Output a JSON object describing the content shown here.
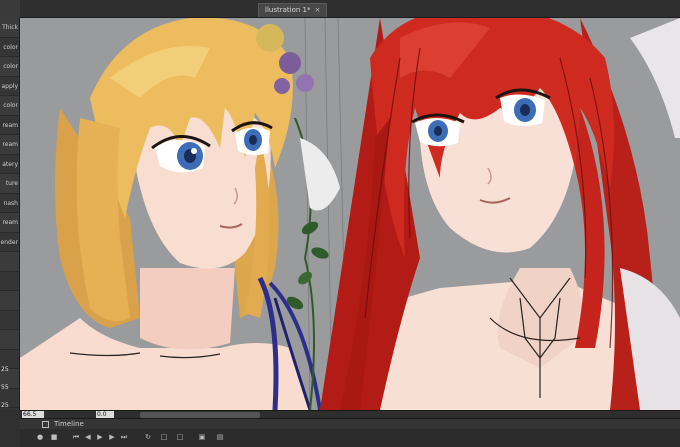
{
  "app": {
    "document_tab": "llustration 1*",
    "tab_close": "×"
  },
  "left_panel": {
    "items": [
      "Thick",
      "color",
      "color",
      "apply",
      "color",
      "ream",
      "ream",
      "atery",
      "ture",
      "nash",
      "ream",
      "ender",
      "",
      "",
      "",
      "",
      "",
      "",
      "",
      ""
    ],
    "numbers": [
      "25",
      "55",
      "25"
    ]
  },
  "status": {
    "zoom": "66.5",
    "rotation": "0.0"
  },
  "timeline": {
    "title": "Timeline",
    "controls": [
      "record-icon",
      "stop-icon",
      "first-frame-icon",
      "prev-frame-icon",
      "play-icon",
      "next-frame-icon",
      "last-frame-icon",
      "loop-icon",
      "add-frame-icon",
      "delete-frame-icon",
      "onion-skin-icon",
      "settings-icon"
    ]
  },
  "colors": {
    "canvas_bg": "#9a9b9d",
    "panel_bg": "#353535",
    "blonde_hair": "#e9b85a",
    "red_hair": "#c8231c",
    "skin": "#f6d9cc",
    "eye_blue": "#3e6db8",
    "ribbon": "#2c2e8c",
    "leaf": "#2f5a2a"
  }
}
